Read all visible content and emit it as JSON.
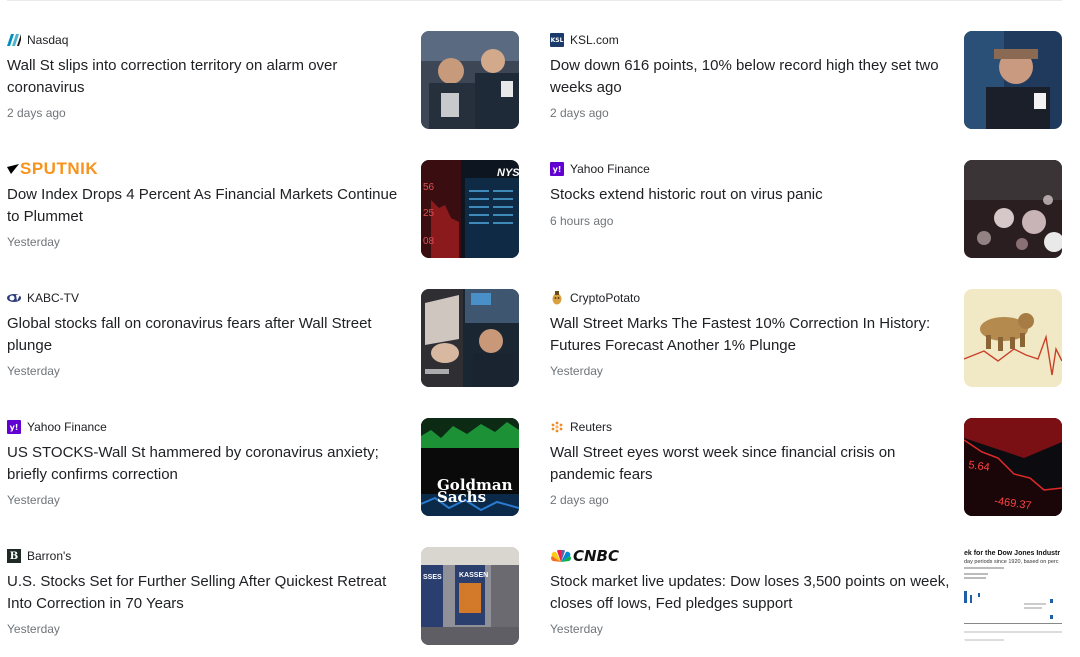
{
  "articles": [
    {
      "source": "Nasdaq",
      "logo_icon": "nasdaq-logo-icon",
      "title": "Wall St slips into correction territory on alarm over coronavirus",
      "time": "2 days ago",
      "thumb": "traders-on-floor"
    },
    {
      "source": "KSL.com",
      "logo_icon": "ksl-logo-icon",
      "title": "Dow down 616 points, 10% below record high they set two weeks ago",
      "time": "2 days ago",
      "thumb": "trader-portrait"
    },
    {
      "source": "SPUTNIK",
      "logo_icon": "sputnik-logo-icon",
      "title": "Dow Index Drops 4 Percent As Financial Markets Continue to Plummet",
      "time": "Yesterday",
      "thumb": "nyse-screen"
    },
    {
      "source": "Yahoo Finance",
      "logo_icon": "yahoo-logo-icon",
      "title": "Stocks extend historic rout on virus panic",
      "time": "6 hours ago",
      "thumb": "bokeh-lights"
    },
    {
      "source": "KABC-TV",
      "logo_icon": "abc7-logo-icon",
      "title": "Global stocks fall on coronavirus fears after Wall Street plunge",
      "time": "Yesterday",
      "thumb": "worried-traders"
    },
    {
      "source": "CryptoPotato",
      "logo_icon": "cryptopotato-logo-icon",
      "title": "Wall Street Marks The Fastest 10% Correction In History: Futures Forecast Another 1% Plunge",
      "time": "Yesterday",
      "thumb": "bear-on-chart"
    },
    {
      "source": "Yahoo Finance",
      "logo_icon": "yahoo-logo-icon",
      "title": "US STOCKS-Wall St hammered by coronavirus anxiety; briefly confirms correction",
      "time": "Yesterday",
      "thumb": "goldman-sachs"
    },
    {
      "source": "Reuters",
      "logo_icon": "reuters-logo-icon",
      "title": "Wall Street eyes worst week since financial crisis on pandemic fears",
      "time": "2 days ago",
      "thumb": "red-board"
    },
    {
      "source": "Barron's",
      "logo_icon": "barrons-logo-icon",
      "title": "U.S. Stocks Set for Further Selling After Quickest Retreat Into Correction in 70 Years",
      "time": "Yesterday",
      "thumb": "kassen-hall"
    },
    {
      "source": "CNBC",
      "logo_icon": "cnbc-logo-icon",
      "title": "Stock market live updates: Dow loses 3,500 points on week, closes off lows, Fed pledges support",
      "time": "Yesterday",
      "thumb": "dow-chart"
    }
  ],
  "thumb_text": {
    "nyse": "NYSE",
    "goldman_line1": "Goldman",
    "goldman_line2": "Sachs",
    "kassen": "KASSEN",
    "chart_title": "ek for the Dow Jones Industr",
    "chart_sub": "day periods since 1920, based on perc"
  },
  "colors": {
    "title": "#202124",
    "meta": "#70757a",
    "sputnik": "#f7931e",
    "yahoo": "#6001d2",
    "ksl": "#1a3a6b",
    "nasdaq": "#0092bc"
  }
}
